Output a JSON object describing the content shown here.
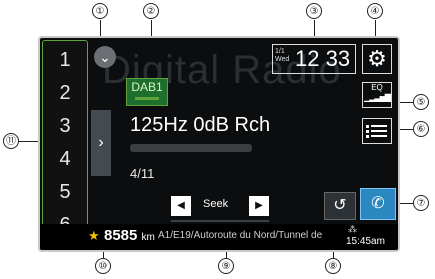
{
  "callouts": {
    "c1": "①",
    "c2": "②",
    "c3": "③",
    "c4": "④",
    "c5": "⑤",
    "c6": "⑥",
    "c7": "⑦",
    "c8": "⑧",
    "c9": "⑨",
    "c10": "⑩",
    "c11": "⑪"
  },
  "screen": {
    "background_text": "Digital Radio",
    "presets": [
      "1",
      "2",
      "3",
      "4",
      "5",
      "6"
    ],
    "source_badge": "DAB1",
    "clock": {
      "date_line1": "1/1",
      "date_line2": "Wed",
      "time": "12 33"
    },
    "eq_label": "EQ",
    "track_title": "125Hz 0dB Rch",
    "track_count": "4/11",
    "seek_label": "Seek",
    "bottom": {
      "distance": "8585",
      "distance_unit": "km",
      "route": "A1/E19/Autoroute du Nord/Tunnel de",
      "time": "15:45am"
    }
  },
  "colors": {
    "accent_green": "#5fa33a",
    "phone_blue": "#2a87c0",
    "star_yellow": "#f2c300"
  },
  "icons": {
    "chevron_down": "chevron-down-icon",
    "chevron_right": "chevron-right-icon",
    "settings": "gear-icon",
    "list": "list-icon",
    "history": "history-icon",
    "phone": "phone-icon",
    "prev": "seek-prev-icon",
    "next": "seek-next-icon",
    "favorite": "star-icon"
  }
}
